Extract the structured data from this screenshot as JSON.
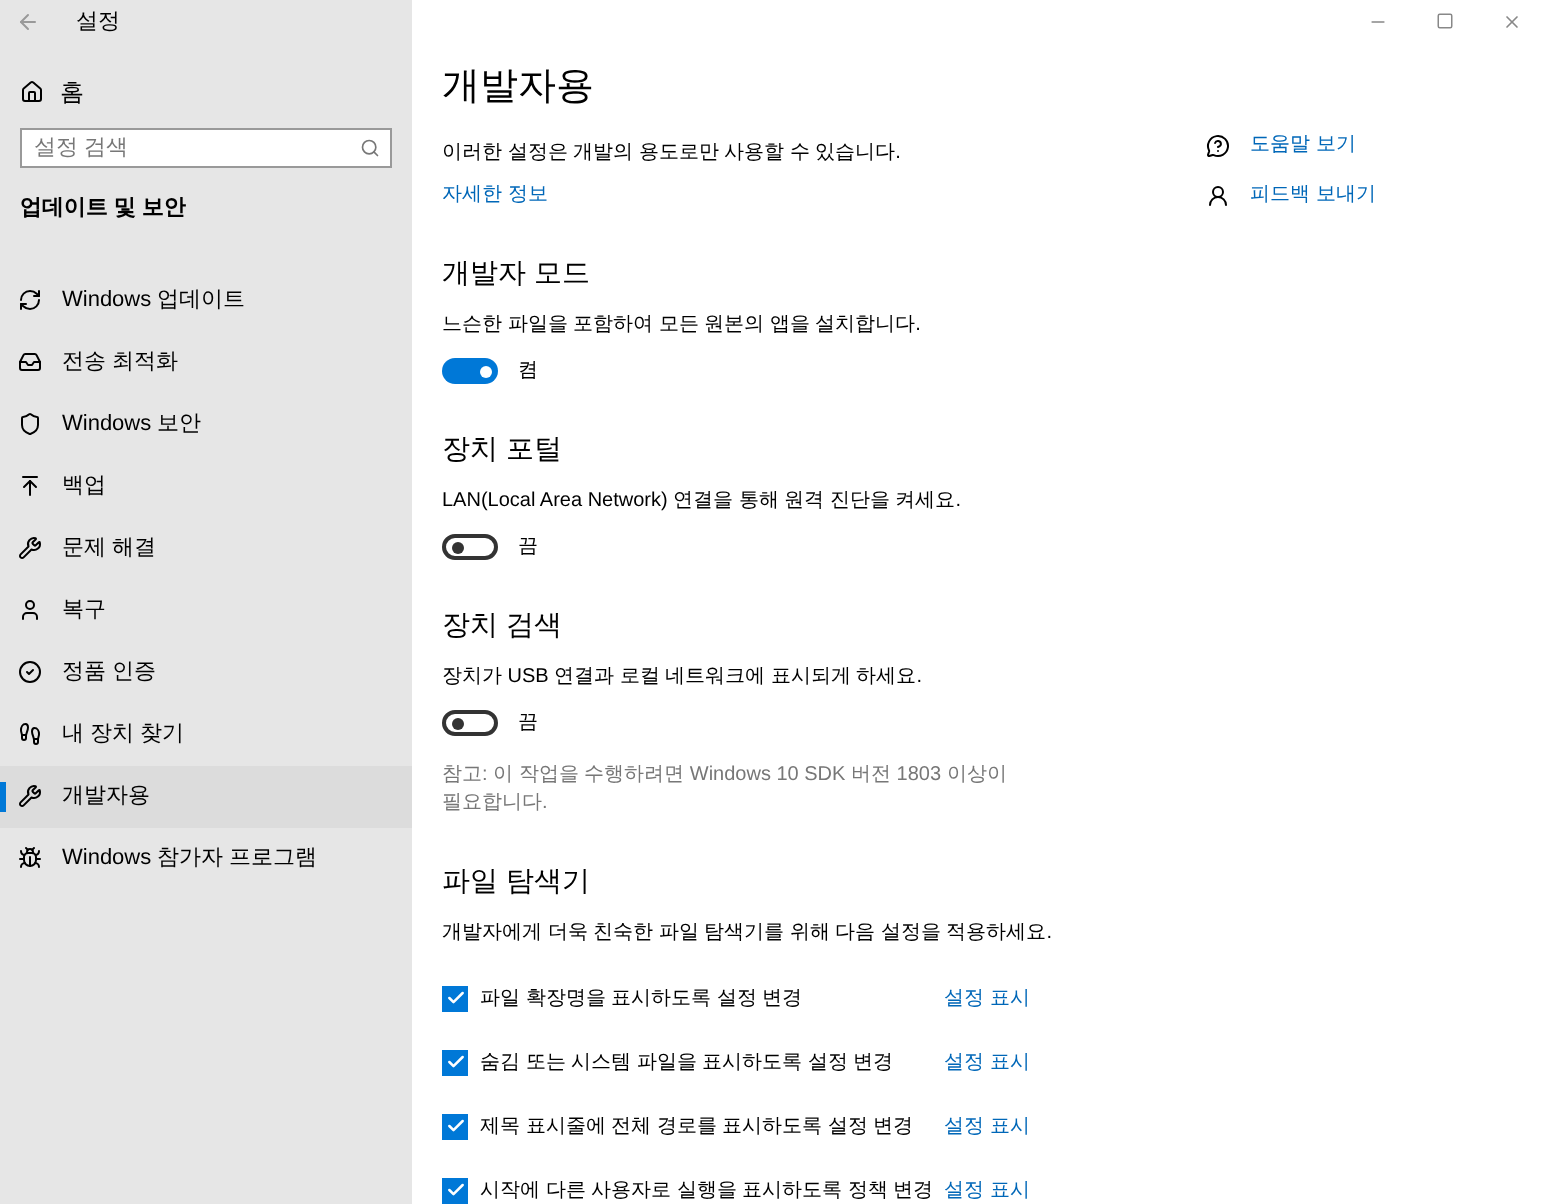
{
  "window": {
    "title": "설정"
  },
  "sidebar": {
    "home": "홈",
    "search": {
      "placeholder": "설정 검색"
    },
    "section": "업데이트 및 보안",
    "items": [
      {
        "label": "Windows 업데이트",
        "selected": false
      },
      {
        "label": "전송 최적화",
        "selected": false
      },
      {
        "label": "Windows 보안",
        "selected": false
      },
      {
        "label": "백업",
        "selected": false
      },
      {
        "label": "문제 해결",
        "selected": false
      },
      {
        "label": "복구",
        "selected": false
      },
      {
        "label": "정품 인증",
        "selected": false
      },
      {
        "label": "내 장치 찾기",
        "selected": false
      },
      {
        "label": "개발자용",
        "selected": true
      },
      {
        "label": "Windows 참가자 프로그램",
        "selected": false
      }
    ]
  },
  "main": {
    "title": "개발자용",
    "intro": "이러한 설정은 개발의 용도로만 사용할 수 있습니다.",
    "more_link": "자세한 정보",
    "help_links": [
      {
        "label": "도움말 보기"
      },
      {
        "label": "피드백 보내기"
      }
    ],
    "sections": [
      {
        "heading": "개발자 모드",
        "description": "느슨한 파일을 포함하여 모든 원본의 앱을 설치합니다.",
        "toggle": {
          "on": true,
          "label": "켬"
        }
      },
      {
        "heading": "장치 포털",
        "description": "LAN(Local Area Network) 연결을 통해 원격 진단을 켜세요.",
        "toggle": {
          "on": false,
          "label": "끔"
        }
      },
      {
        "heading": "장치 검색",
        "description": "장치가 USB 연결과 로컬 네트워크에 표시되게 하세요.",
        "toggle": {
          "on": false,
          "label": "끔"
        },
        "note": "참고: 이 작업을 수행하려면 Windows 10 SDK 버전 1803 이상이 필요합니다."
      }
    ],
    "file_explorer": {
      "heading": "파일 탐색기",
      "description": "개발자에게 더욱 친숙한 파일 탐색기를 위해 다음 설정을 적용하세요.",
      "options": [
        {
          "label": "파일 확장명을 표시하도록 설정 변경",
          "checked": true,
          "link": "설정 표시"
        },
        {
          "label": "숨김 또는 시스템 파일을 표시하도록 설정 변경",
          "checked": true,
          "link": "설정 표시"
        },
        {
          "label": "제목 표시줄에 전체 경로를 표시하도록 설정 변경",
          "checked": true,
          "link": "설정 표시"
        },
        {
          "label": "시작에 다른 사용자로 실행을 표시하도록 정책 변경",
          "checked": true,
          "link": "설정 표시"
        }
      ]
    }
  }
}
